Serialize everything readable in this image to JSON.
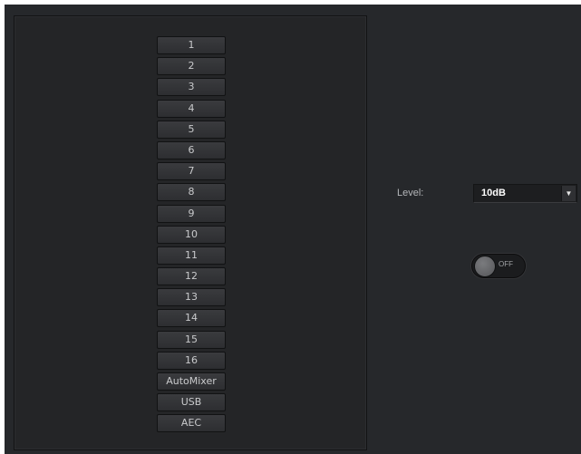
{
  "channels": [
    "1",
    "2",
    "3",
    "4",
    "5",
    "6",
    "7",
    "8",
    "9",
    "10",
    "11",
    "12",
    "13",
    "14",
    "15",
    "16",
    "AutoMixer",
    "USB",
    "AEC"
  ],
  "level": {
    "label": "Level:",
    "value": "10dB"
  },
  "toggle": {
    "state_label": "OFF"
  },
  "colors": {
    "background": "#26282b",
    "panel": "#242527",
    "button": "#333437",
    "text": "#c9cacc"
  }
}
